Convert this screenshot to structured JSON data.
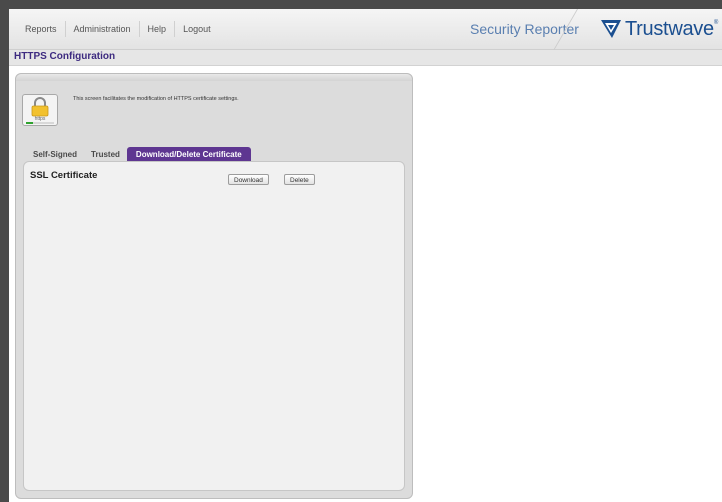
{
  "nav": {
    "items": [
      {
        "label": "Reports"
      },
      {
        "label": "Administration"
      },
      {
        "label": "Help"
      },
      {
        "label": "Logout"
      }
    ]
  },
  "header": {
    "product_name": "Security Reporter",
    "brand_name": "Trustwave",
    "brand_tm": "®",
    "brand_color": "#1b4f90"
  },
  "page": {
    "title": "HTTPS Configuration",
    "description": "This screen facilitates the modification of HTTPS certificate settings.",
    "icon_text": "https",
    "accent_color": "#5e3691"
  },
  "tabs": [
    {
      "label": "Self-Signed",
      "active": false
    },
    {
      "label": "Trusted",
      "active": false
    },
    {
      "label": "Download/Delete Certificate",
      "active": true
    }
  ],
  "section": {
    "title": "SSL Certificate",
    "download_label": "Download",
    "delete_label": "Delete"
  }
}
